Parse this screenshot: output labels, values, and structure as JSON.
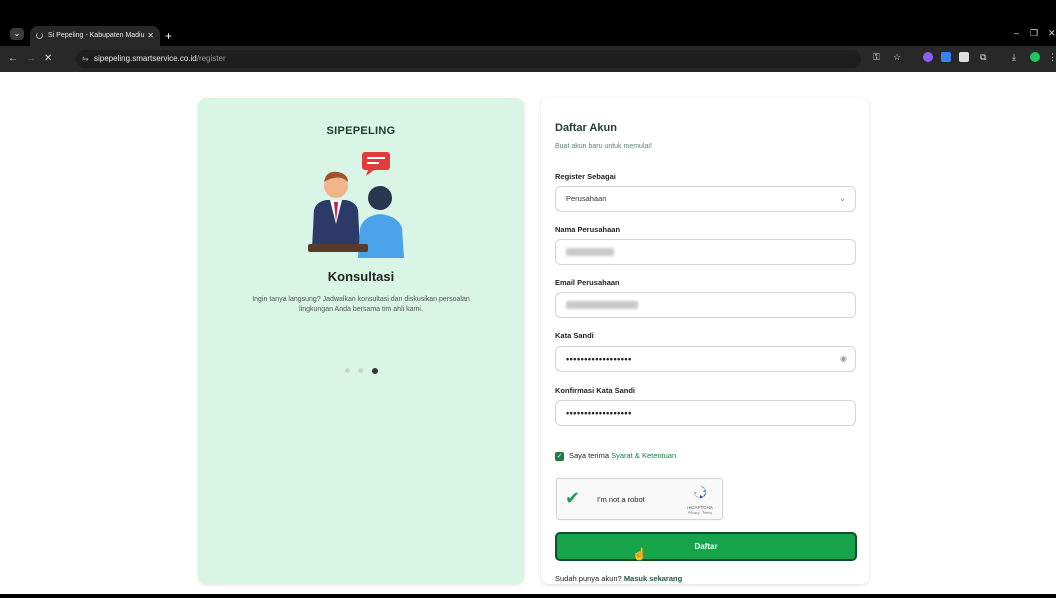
{
  "browser": {
    "tab_title": "Si Pepeling - Kabupaten Madiu",
    "url_host": "sipepeling.smartservice.co.id",
    "url_path": "/register"
  },
  "slider": {
    "brand": "SIPEPELING",
    "title": "Konsultasi",
    "description": "Ingin tanya langsung? Jadwalkan konsultasi dan diskusikan persoalan lingkungan Anda bersama tim ahli kami.",
    "active_index": 3,
    "total": 3
  },
  "form": {
    "title": "Daftar Akun",
    "subtitle": "Buat akun baru untuk memulai!",
    "register_as_label": "Register Sebagai",
    "register_as_value": "Perusahaan",
    "company_name_label": "Nama Perusahaan",
    "company_email_label": "Email Perusahaan",
    "password_label": "Kata Sandi",
    "password_value": "••••••••••••••••••",
    "confirm_label": "Konfirmasi Kata Sandi",
    "confirm_value": "••••••••••••••••••",
    "terms_prefix": "Saya terima ",
    "terms_link": "Syarat & Ketentuan",
    "captcha_label": "I'm not a robot",
    "captcha_brand": "reCAPTCHA",
    "captcha_legal": "Privacy - Terms",
    "submit_label": "Daftar",
    "login_prompt": "Sudah punya akun? ",
    "login_link": "Masuk sekarang"
  },
  "colors": {
    "accent": "#16a34a",
    "left_panel": "#d9f5e6"
  }
}
